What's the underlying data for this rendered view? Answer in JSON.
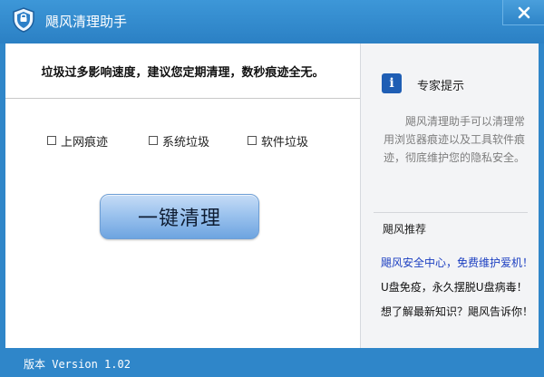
{
  "app": {
    "title": "飓风清理助手"
  },
  "main": {
    "headline": "垃圾过多影响速度，建议您定期清理，数秒痕迹全无。",
    "options": [
      {
        "label": "上网痕迹",
        "checked": false
      },
      {
        "label": "系统垃圾",
        "checked": false
      },
      {
        "label": "软件垃圾",
        "checked": false
      }
    ],
    "clean_button": "一键清理"
  },
  "sidebar": {
    "tip_icon_glyph": "i",
    "tip_title": "专家提示",
    "tip_text": "飓风清理助手可以清理常用浏览器痕迹以及工具软件痕迹，彻底维护您的隐私安全。",
    "recommend_title": "飓风推荐",
    "recommend_items": [
      {
        "text": "飓风安全中心，免费维护爱机！",
        "color": "#1c3fc1"
      },
      {
        "text": "U盘免疫，永久摆脱U盘病毒！",
        "color": "#111111"
      },
      {
        "text": "想了解最新知识？飓风告诉你！",
        "color": "#111111"
      }
    ]
  },
  "statusbar": {
    "version": "版本 Version 1.02"
  },
  "colors": {
    "frame": "#2f86c9",
    "link": "#1c3fc1",
    "button_gradient_top": "#c6dcf6",
    "button_gradient_bottom": "#6ea4e0"
  },
  "icons": {
    "app": "shield-icon",
    "close": "close-icon",
    "tip": "info-icon"
  }
}
